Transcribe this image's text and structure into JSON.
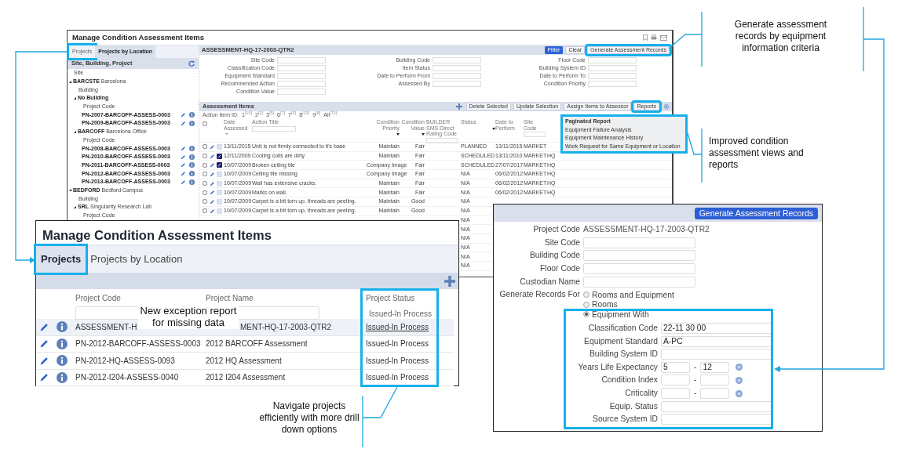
{
  "main_window": {
    "title": "Manage Condition Assessment Items",
    "tabs": [
      {
        "label": "Projects",
        "selected": false
      },
      {
        "label": "Projects by Location",
        "selected": true
      }
    ],
    "tree_panel": {
      "title": "Site, Building, Project",
      "items": [
        {
          "kind": "label",
          "text": "Site"
        },
        {
          "kind": "node",
          "code": "BARCSTE",
          "name": "Barcelona",
          "expanded": true,
          "children": [
            {
              "kind": "label",
              "text": "Building"
            },
            {
              "kind": "node",
              "code": "No Building",
              "expanded": true,
              "children": [
                {
                  "kind": "label",
                  "text": "Project Code"
                },
                {
                  "kind": "project",
                  "text": "PN-2007-BARCOFF-ASSESS-0003"
                },
                {
                  "kind": "project",
                  "text": "PN-2009-BARCOFF-ASSESS-0003"
                }
              ]
            },
            {
              "kind": "node",
              "code": "BARCOFF",
              "name": "Barcelona Office",
              "expanded": true,
              "children": [
                {
                  "kind": "label",
                  "text": "Project Code"
                },
                {
                  "kind": "project",
                  "text": "PN-2008-BARCOFF-ASSESS-0003"
                },
                {
                  "kind": "project",
                  "text": "PN-2010-BARCOFF-ASSESS-0003"
                },
                {
                  "kind": "project",
                  "text": "PN-2011-BARCOFF-ASSESS-0003"
                },
                {
                  "kind": "project",
                  "text": "PN-2012-BARCOFF-ASSESS-0003"
                },
                {
                  "kind": "project",
                  "text": "PN-2013-BARCOFF-ASSESS-0003"
                }
              ]
            }
          ]
        },
        {
          "kind": "node",
          "code": "BEDFORD",
          "name": "Bedford Campus",
          "expanded": true,
          "children": [
            {
              "kind": "label",
              "text": "Building"
            },
            {
              "kind": "node",
              "code": "SRL",
              "name": "Singularity Research Lab",
              "expanded": true,
              "children": [
                {
                  "kind": "label",
                  "text": "Project Code"
                }
              ]
            }
          ]
        }
      ]
    },
    "detail": {
      "title": "ASSESSMENT-HQ-17-2003-QTR2",
      "buttons": [
        {
          "label": "Filter",
          "kind": "primary"
        },
        {
          "label": "Clear",
          "kind": "plain"
        },
        {
          "label": "Generate Assessment Records",
          "kind": "plain"
        }
      ],
      "filter_columns": [
        [
          "Site Code",
          "Classification Code",
          "Equipment Standard",
          "Recommended Action",
          "Condition Value"
        ],
        [
          "Building Code",
          "Item Status",
          "Date to Perform From",
          "Assessed By"
        ],
        [
          "Floor Code",
          "Building System ID",
          "Date to Perform To",
          "Condition Priority"
        ]
      ]
    },
    "items": {
      "title": "Assessment Items",
      "buttons": [
        "Delete Selected",
        "Update Selection",
        "Assign Items to Assessor",
        "Reports"
      ],
      "action_id_label": "Action Item ID:",
      "select_all_checked": false,
      "action_ids": [
        {
          "id": "1",
          "count": "[10]"
        },
        {
          "id": "2",
          "count": "[2]"
        },
        {
          "id": "3",
          "count": "[5]"
        },
        {
          "id": "6",
          "count": "[7]"
        },
        {
          "id": "7",
          "count": "[9]"
        },
        {
          "id": "8",
          "count": "[10]"
        },
        {
          "id": "9",
          "count": "[8]"
        },
        {
          "id": "All",
          "count": "[70]"
        }
      ],
      "columns": [
        "Date Assessed",
        "Action Title",
        "Condition Priority",
        "Condition Value",
        "BUILDER SMS Direct Rating Code",
        "Status",
        "Date to Perform",
        "Site Code"
      ],
      "rows": [
        {
          "checked": false,
          "document": false,
          "date": "13/11/2015",
          "title": "Unit is not firmly connected to it's base",
          "priority": "Maintain",
          "value": "Fair",
          "status": "PLANNED",
          "perform": "13/11/2015",
          "site": "MARKET"
        },
        {
          "checked": false,
          "document": true,
          "date": "12/11/2009",
          "title": "Cooling coils are dirty.",
          "priority": "Maintain",
          "value": "Fair",
          "status": "SCHEDULED",
          "perform": "13/11/2010",
          "site": "MARKET",
          "building": "HQ"
        },
        {
          "checked": false,
          "document": true,
          "date": "10/07/2009",
          "title": "Broken ceiling tile",
          "priority": "Company Image",
          "value": "Fair",
          "status": "SCHEDULED",
          "perform": "27/07/2017",
          "site": "MARKET",
          "building": "HQ"
        },
        {
          "checked": false,
          "document": false,
          "date": "10/07/2009",
          "title": "Ceiling tile missing",
          "priority": "Company Image",
          "value": "Fair",
          "status": "N/A",
          "perform": "06/02/2012",
          "site": "MARKET",
          "building": "HQ"
        },
        {
          "checked": false,
          "document": false,
          "date": "10/07/2009",
          "title": "Wall has extensive cracks.",
          "priority": "Maintain",
          "value": "Fair",
          "status": "N/A",
          "perform": "06/02/2012",
          "site": "MARKET",
          "building": "HQ"
        },
        {
          "checked": false,
          "document": false,
          "date": "10/07/2009",
          "title": "Marks on wall.",
          "priority": "Maintain",
          "value": "Fair",
          "status": "N/A",
          "perform": "06/02/2012",
          "site": "MARKET",
          "building": "HQ"
        },
        {
          "checked": false,
          "document": false,
          "date": "10/07/2009",
          "title": "Carpet is a bit torn up, threads are peeling.",
          "priority": "Maintain",
          "value": "Good",
          "status": "N/A"
        },
        {
          "checked": false,
          "document": false,
          "date": "10/07/2009",
          "title": "Carpet is a bit torn up, threads are peeling.",
          "priority": "Maintain",
          "value": "Good",
          "status": "N/A"
        },
        {
          "status": "N/A"
        },
        {
          "status": "N/A"
        },
        {
          "status": "N/A"
        },
        {
          "status": "N/A"
        },
        {
          "status": "N/A"
        },
        {
          "status": "N/A"
        }
      ]
    },
    "reports_menu": [
      "Paginated Report",
      "Equipment Failure Analysis",
      "Equipment Maintenance History",
      "Work Request for Same Equipment or Location"
    ]
  },
  "projects_window": {
    "title": "Manage Condition Assessment Items",
    "tabs": [
      {
        "label": "Projects",
        "selected": true
      },
      {
        "label": "Projects by Location",
        "selected": false
      }
    ],
    "columns": [
      "Project Code",
      "Project Name",
      "Project Status"
    ],
    "status_filter": "Issued-In Process",
    "rows": [
      {
        "code": "ASSESSMENT-H",
        "name": "MENT-HQ-17-2003-QTR2",
        "status": "Issued-In Process",
        "selected": true
      },
      {
        "code": "PN-2012-BARCOFF-ASSESS-0003",
        "name": "2012 BARCOFF Assessment",
        "status": "Issued-In Process",
        "selected": false
      },
      {
        "code": "PN-2012-HQ-ASSESS-0093",
        "name": "2012 HQ Assessment",
        "status": "Issued-In Process",
        "selected": false
      },
      {
        "code": "PN-2012-I204-ASSESS-0040",
        "name": "2012 I204 Assessment",
        "status": "Issued-In Process",
        "selected": false
      }
    ]
  },
  "generate_window": {
    "button": "Generate Assessment Records",
    "project_code": {
      "label": "Project Code",
      "value": "ASSESSMENT-HQ-17-2003-QTR2"
    },
    "fields": [
      "Site Code",
      "Building Code",
      "Floor Code",
      "Custodian Name"
    ],
    "generate_for": {
      "label": "Generate Records For",
      "options": [
        {
          "label": "Rooms and Equipment",
          "selected": false
        },
        {
          "label": "Rooms",
          "selected": false
        },
        {
          "label": "Equipment With",
          "selected": true
        }
      ]
    },
    "criteria": [
      {
        "kind": "text",
        "label": "Classification Code",
        "value": "22-11 30 00"
      },
      {
        "kind": "text",
        "label": "Equipment Standard",
        "value": "A-PC"
      },
      {
        "kind": "text",
        "label": "Building System ID"
      },
      {
        "kind": "range",
        "label": "Years Life Expectancy",
        "from": "5",
        "separator": "-",
        "to": "12"
      },
      {
        "kind": "range",
        "label": "Condition Index",
        "separator": "-"
      },
      {
        "kind": "range",
        "label": "Criticality",
        "separator": "-"
      },
      {
        "kind": "text",
        "label": "Equip. Status"
      },
      {
        "kind": "text",
        "label": "Source System ID"
      }
    ]
  },
  "callouts": [
    "Generate assessment records by equipment information criteria",
    "Improved condition assessment views and reports",
    "Navigate projects efficiently with more drill down options",
    "New exception report for missing data"
  ]
}
